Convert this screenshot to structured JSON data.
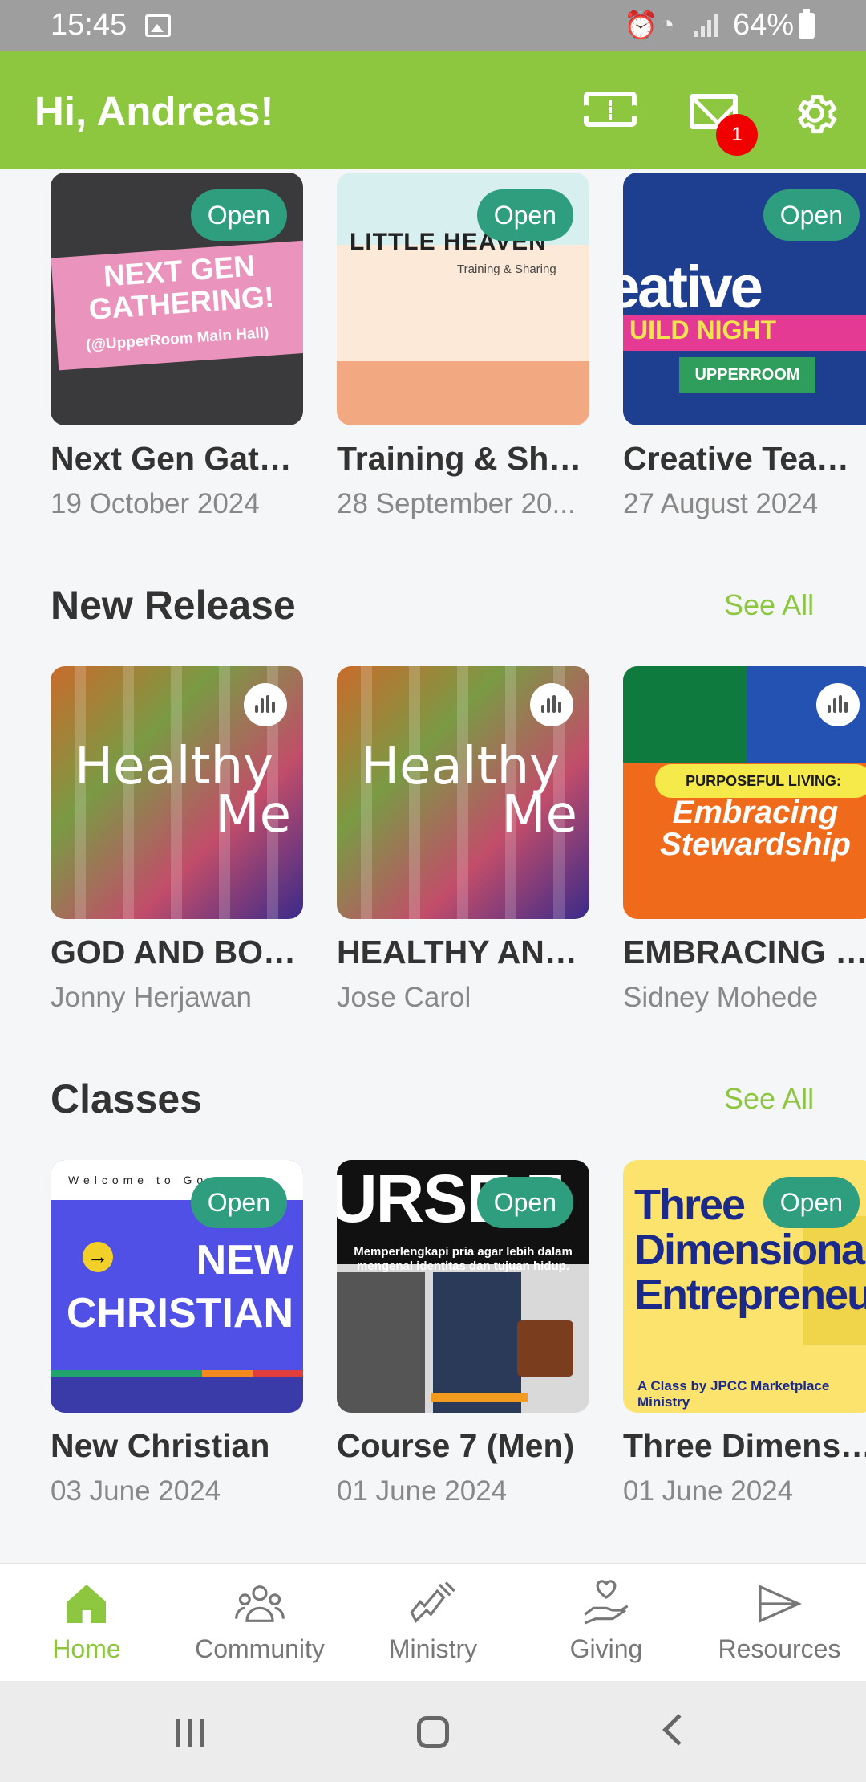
{
  "status_bar": {
    "time": "15:45",
    "battery": "64%",
    "icons": [
      "image-icon",
      "alarm-icon",
      "wifi-icon",
      "signal-icon",
      "battery-icon"
    ]
  },
  "header": {
    "greeting": "Hi, Andreas!",
    "notification_count": "1",
    "icons": [
      "ticket-icon",
      "mail-icon",
      "gear-icon"
    ],
    "accent_color": "#8dc63f"
  },
  "events": {
    "items": [
      {
        "badge": "Open",
        "title": "Next Gen Gath...",
        "date": "19 October 2024",
        "art_big": "NEXT GEN GATHERING!",
        "art_small": "(@UpperRoom Main Hall)"
      },
      {
        "badge": "Open",
        "title": "Training & Sha...",
        "date": "28 September 20...",
        "art_big": "LITTLE HEAVEN",
        "art_small": "Training & Sharing"
      },
      {
        "badge": "Open",
        "title": "Creative Team ...",
        "date": "27 August 2024",
        "art_big": "eative",
        "art_band": "UILD NIGHT",
        "art_small": "UPPERROOM"
      }
    ]
  },
  "new_release": {
    "title": "New Release",
    "see_all": "See All",
    "items": [
      {
        "title": "GOD AND BOD...",
        "author": "Jonny Herjawan",
        "art_line1": "Healthy",
        "art_line2": "Me"
      },
      {
        "title": "HEALTHY AND...",
        "author": "Jose Carol",
        "art_line1": "Healthy",
        "art_line2": "Me"
      },
      {
        "title": "EMBRACING S...",
        "author": "Sidney Mohede",
        "art_band": "PURPOSEFUL LIVING:",
        "art_big": "Embracing Stewardship"
      }
    ]
  },
  "classes": {
    "title": "Classes",
    "see_all": "See All",
    "items": [
      {
        "badge": "Open",
        "title": "New Christian",
        "date": "03 June 2024",
        "art_top": "Welcome to Go",
        "art_big": "NEW CHRISTIAN"
      },
      {
        "badge": "Open",
        "title": "Course 7 (Men)",
        "date": "01 June 2024",
        "art_big": "URSE 7",
        "art_small": "Memperlengkapi pria agar lebih dalam mengenal identitas dan tujuan hidup."
      },
      {
        "badge": "Open",
        "title": "Three Dimensi...",
        "date": "01 June 2024",
        "art_big": "Three Dimensional Entrepreneur",
        "art_small": "A Class by JPCC Marketplace Ministry"
      }
    ]
  },
  "bottom_nav": {
    "items": [
      {
        "label": "Home",
        "icon": "home-icon",
        "active": true
      },
      {
        "label": "Community",
        "icon": "community-icon",
        "active": false
      },
      {
        "label": "Ministry",
        "icon": "ministry-icon",
        "active": false
      },
      {
        "label": "Giving",
        "icon": "giving-icon",
        "active": false
      },
      {
        "label": "Resources",
        "icon": "resources-icon",
        "active": false
      }
    ]
  }
}
